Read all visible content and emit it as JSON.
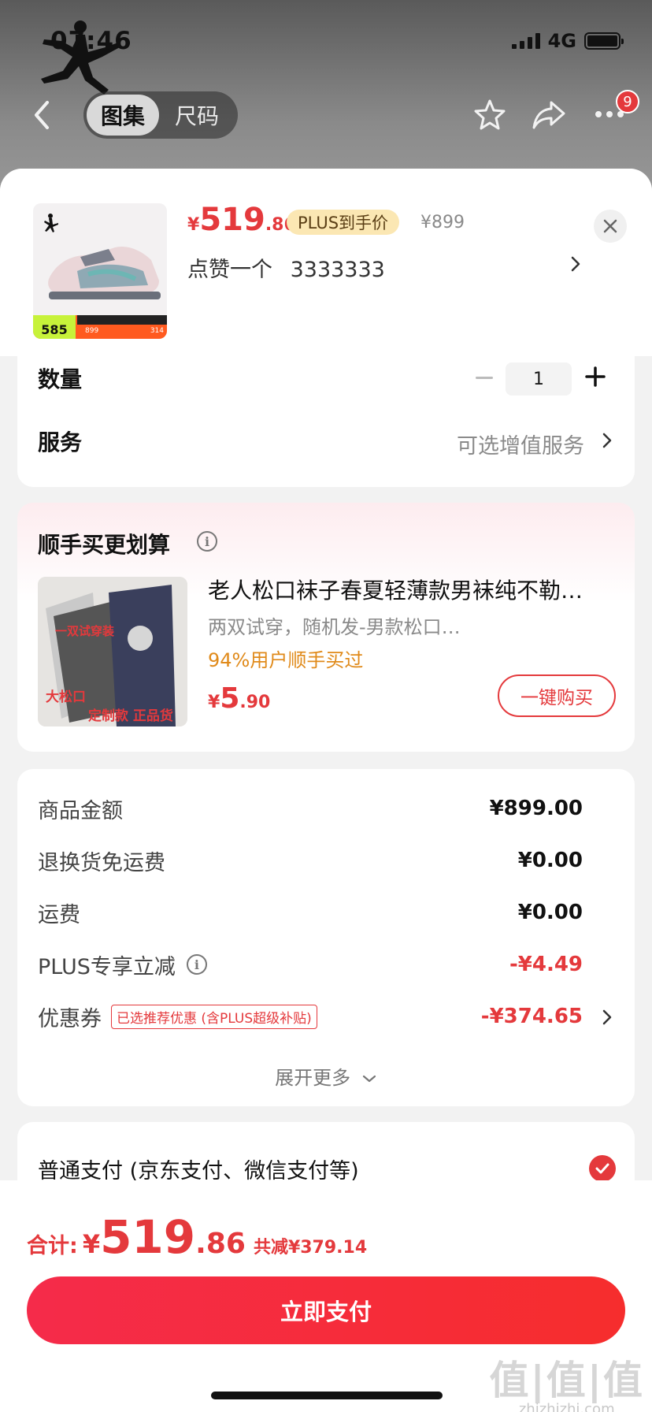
{
  "status_bar": {
    "time": "07:46",
    "network": "4G"
  },
  "nav": {
    "tabs": [
      {
        "label": "图集",
        "active": true
      },
      {
        "label": "尺码",
        "active": false
      }
    ],
    "badge_count": "9",
    "icons": [
      "back-icon",
      "star-icon",
      "share-icon",
      "more-icon"
    ]
  },
  "product": {
    "price_yen": "¥",
    "price_int": "519",
    "price_dec": ".86",
    "plus_tag": "PLUS到手价",
    "original_price": "¥899",
    "spec_label": "点赞一个",
    "spec_value": "3333333",
    "thumb": {
      "promo_price": "585",
      "promo_a": "899",
      "promo_b": "314"
    }
  },
  "quantity": {
    "label": "数量",
    "value": "1"
  },
  "service": {
    "label": "服务",
    "value": "可选增值服务"
  },
  "recommend": {
    "title": "顺手买更划算",
    "item_name": "老人松口袜子春夏轻薄款男袜纯不勒…",
    "item_sub": "两双试穿，随机发-男款松口…",
    "item_pct": "94%用户顺手买过",
    "price_yen": "¥",
    "price_int": "5",
    "price_dec": ".90",
    "buy_label": "一键购买",
    "img_text": {
      "a": "一双试穿装",
      "b": "大松口",
      "c": "定制款 正品货"
    }
  },
  "summary": {
    "rows": [
      {
        "label": "商品金额",
        "value": "¥899.00"
      },
      {
        "label": "退换货免运费",
        "value": "¥0.00"
      },
      {
        "label": "运费",
        "value": "¥0.00"
      },
      {
        "label": "PLUS专享立减",
        "value": "-¥4.49"
      },
      {
        "label": "优惠券",
        "value": "-¥374.65",
        "tag": "已选推荐优惠 (含PLUS超级补贴)"
      }
    ],
    "expand_label": "展开更多"
  },
  "payment": {
    "label": "普通支付 (京东支付、微信支付等)"
  },
  "footer": {
    "total_label": "合计:",
    "total_yen": "¥",
    "total_int": "519",
    "total_dec": ".86",
    "total_saving": "共减¥379.14",
    "pay_button": "立即支付"
  },
  "watermark": {
    "cn": "值|值|值",
    "en": "zhizhizhi.com"
  },
  "colors": {
    "accent": "#e4393c",
    "plus_tag_bg": "#fbe7b3",
    "pct_text": "#e08a1a"
  }
}
